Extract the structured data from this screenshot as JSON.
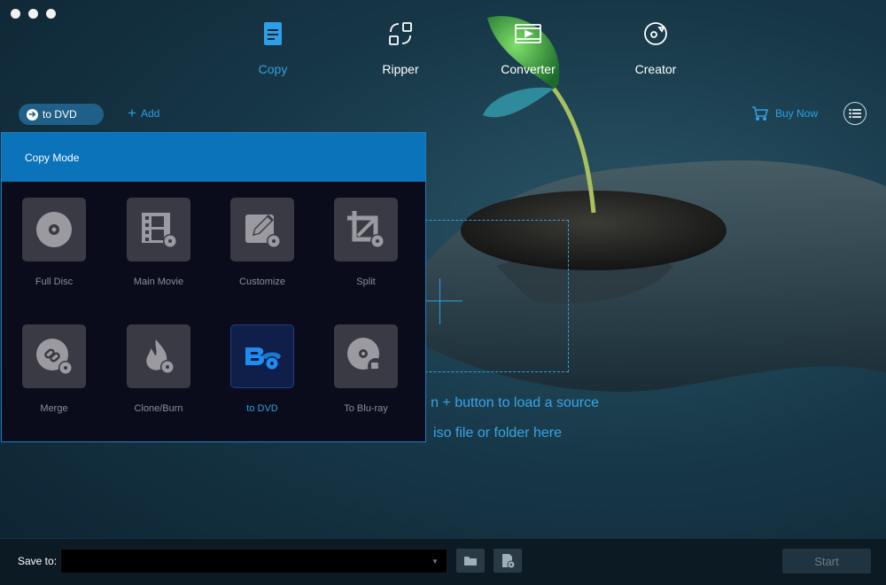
{
  "window": {
    "controls": [
      "close",
      "minimize",
      "maximize"
    ]
  },
  "nav": {
    "items": [
      {
        "label": "Copy",
        "icon": "copy-icon",
        "active": true
      },
      {
        "label": "Ripper",
        "icon": "ripper-icon",
        "active": false
      },
      {
        "label": "Converter",
        "icon": "converter-icon",
        "active": false
      },
      {
        "label": "Creator",
        "icon": "creator-icon",
        "active": false
      }
    ]
  },
  "toolbar": {
    "target_label": "to DVD",
    "add_label": "Add",
    "buy_now_label": "Buy Now"
  },
  "panel": {
    "title": "Copy Mode",
    "modes": [
      {
        "label": "Full Disc",
        "icon": "disc-icon",
        "selected": false
      },
      {
        "label": "Main Movie",
        "icon": "film-icon",
        "selected": false
      },
      {
        "label": "Customize",
        "icon": "edit-icon",
        "selected": false
      },
      {
        "label": "Split",
        "icon": "crop-icon",
        "selected": false
      },
      {
        "label": "Merge",
        "icon": "link-icon",
        "selected": false
      },
      {
        "label": "Clone/Burn",
        "icon": "flame-icon",
        "selected": false
      },
      {
        "label": "to DVD",
        "icon": "bluray-to-dvd-icon",
        "selected": true
      },
      {
        "label": "To Blu-ray",
        "icon": "to-bluray-icon",
        "selected": false
      }
    ]
  },
  "dropzone": {
    "hint_line1": "n + button to load a source",
    "hint_line2": "iso file or folder here"
  },
  "footer": {
    "save_label": "Save to:",
    "save_value": "",
    "start_label": "Start"
  },
  "colors": {
    "accent": "#2e9fe6",
    "panel_header": "#0a73b9",
    "panel_bg": "#0b0c1b"
  }
}
